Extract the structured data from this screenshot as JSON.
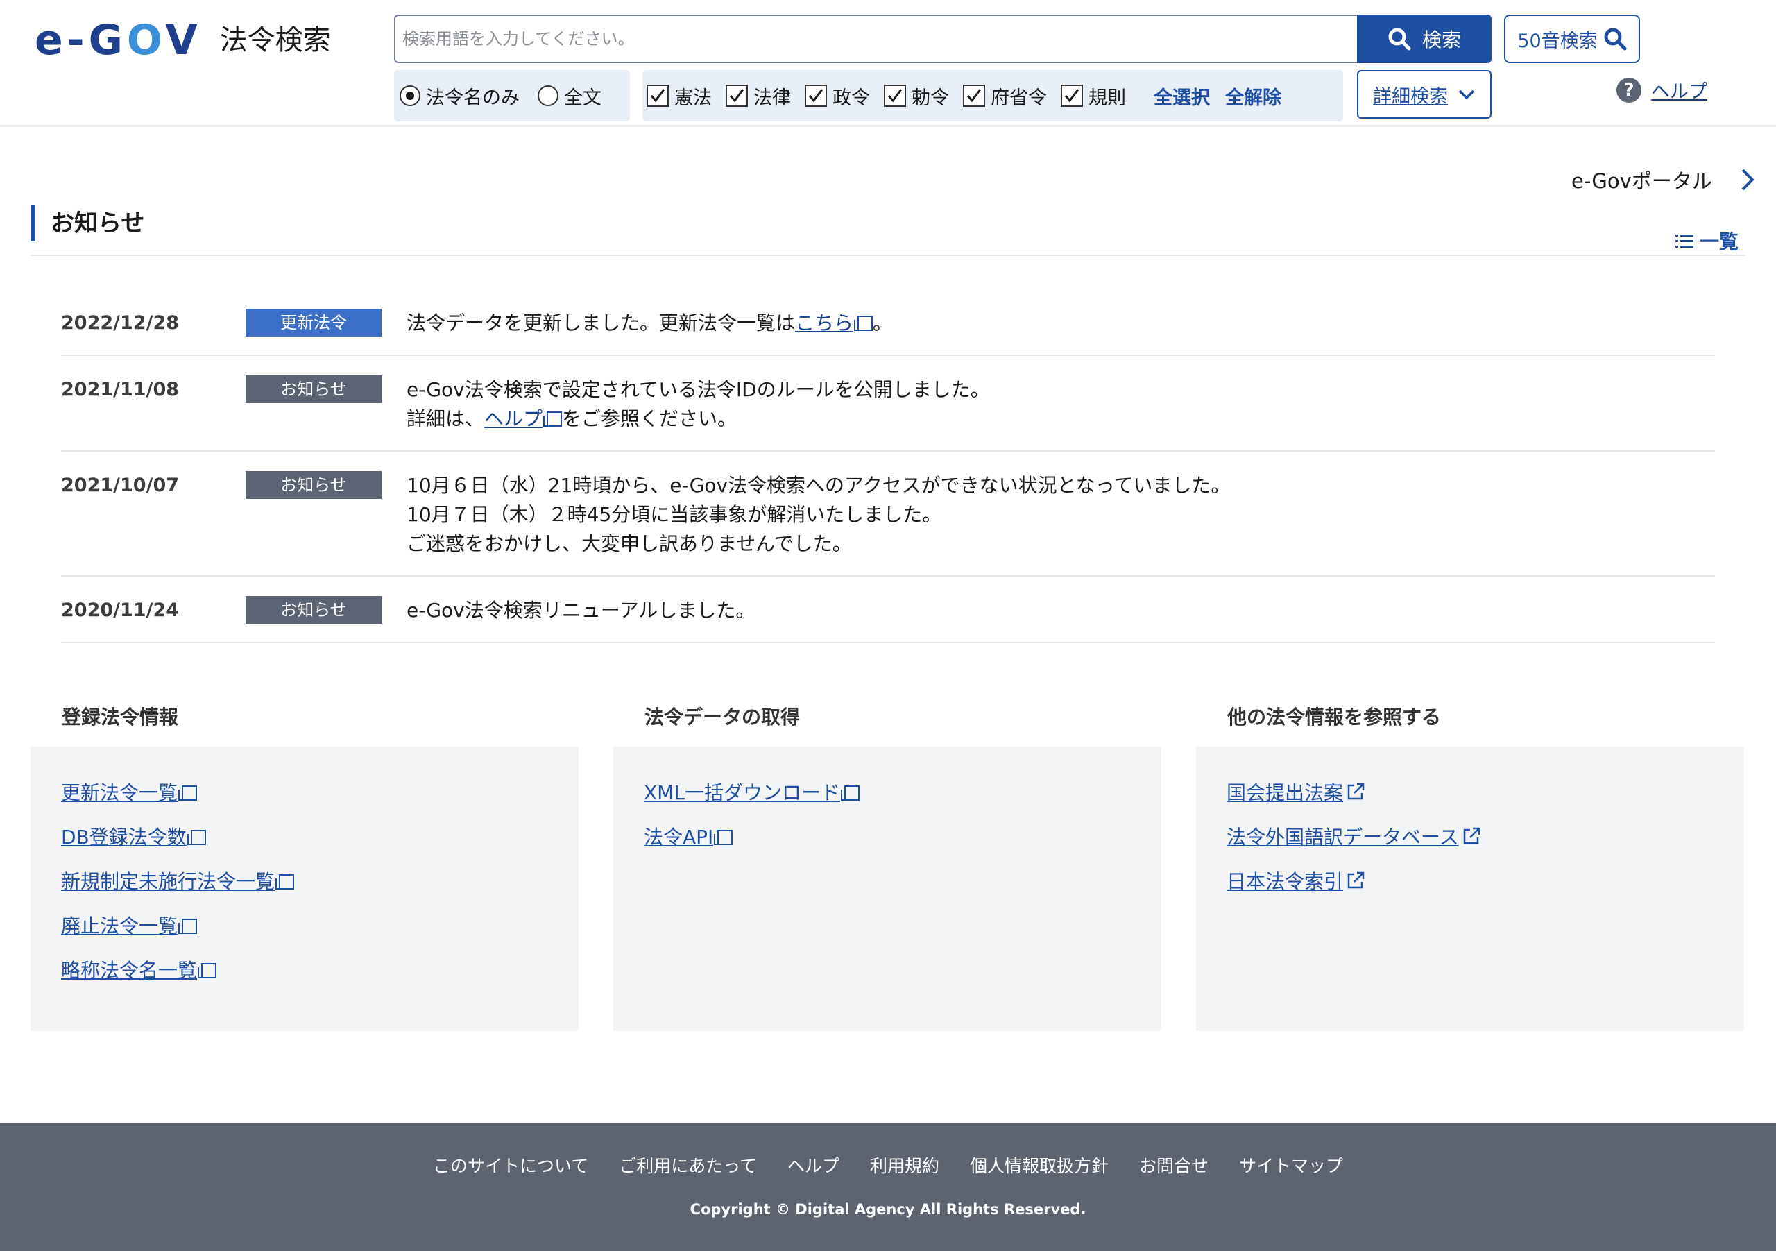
{
  "header": {
    "logo_text_a": "e-G",
    "logo_text_o": "O",
    "logo_text_b": "V",
    "title": "法令検索",
    "search_placeholder": "検索用語を入力してください。",
    "search_button": "検索",
    "kana_search_button": "50音検索",
    "scope_name_only": "法令名のみ",
    "scope_full_text": "全文",
    "law_types": [
      "憲法",
      "法律",
      "政令",
      "勅令",
      "府省令",
      "規則"
    ],
    "select_all": "全選択",
    "deselect_all": "全解除",
    "advanced_search": "詳細検索",
    "help": "ヘルプ"
  },
  "portal_link": "e-Govポータル",
  "notices": {
    "title": "お知らせ",
    "all_link": "一覧",
    "items": [
      {
        "date": "2022/12/28",
        "badge": "更新法令",
        "line1_before": "法令データを更新しました。更新法令一覧は",
        "line1_link": "こちら",
        "line1_after": "。"
      },
      {
        "date": "2021/11/08",
        "badge": "お知らせ",
        "line1": "e-Gov法令検索で設定されている法令IDのルールを公開しました。",
        "line2_before": "詳細は、",
        "line2_link": "ヘルプ",
        "line2_after": "をご参照ください。"
      },
      {
        "date": "2021/10/07",
        "badge": "お知らせ",
        "line1": "10月６日（水）21時頃から、e-Gov法令検索へのアクセスができない状況となっていました。",
        "line2": "10月７日（木）２時45分頃に当該事象が解消いたしました。",
        "line3": "ご迷惑をおかけし、大変申し訳ありませんでした。"
      },
      {
        "date": "2020/11/24",
        "badge": "お知らせ",
        "line1": "e-Gov法令検索リニューアルしました。"
      }
    ]
  },
  "columns": [
    {
      "heading": "登録法令情報",
      "links": [
        "更新法令一覧",
        "DB登録法令数",
        "新規制定未施行法令一覧",
        "廃止法令一覧",
        "略称法令名一覧"
      ]
    },
    {
      "heading": "法令データの取得",
      "links": [
        "XML一括ダウンロード",
        "法令API"
      ]
    },
    {
      "heading": "他の法令情報を参照する",
      "links": [
        "国会提出法案",
        "法令外国語訳データベース",
        "日本法令索引"
      ]
    }
  ],
  "footer": {
    "nav": [
      "このサイトについて",
      "ご利用にあたって",
      "ヘルプ",
      "利用規約",
      "個人情報取扱方針",
      "お問合せ",
      "サイトマップ"
    ],
    "copyright": "Copyright © Digital Agency All Rights Reserved."
  },
  "colors": {
    "brand_blue": "#1f4fa3",
    "badge_update": "#3e6fc6",
    "badge_notice": "#5c6373",
    "footer_bg": "#5d6470"
  }
}
